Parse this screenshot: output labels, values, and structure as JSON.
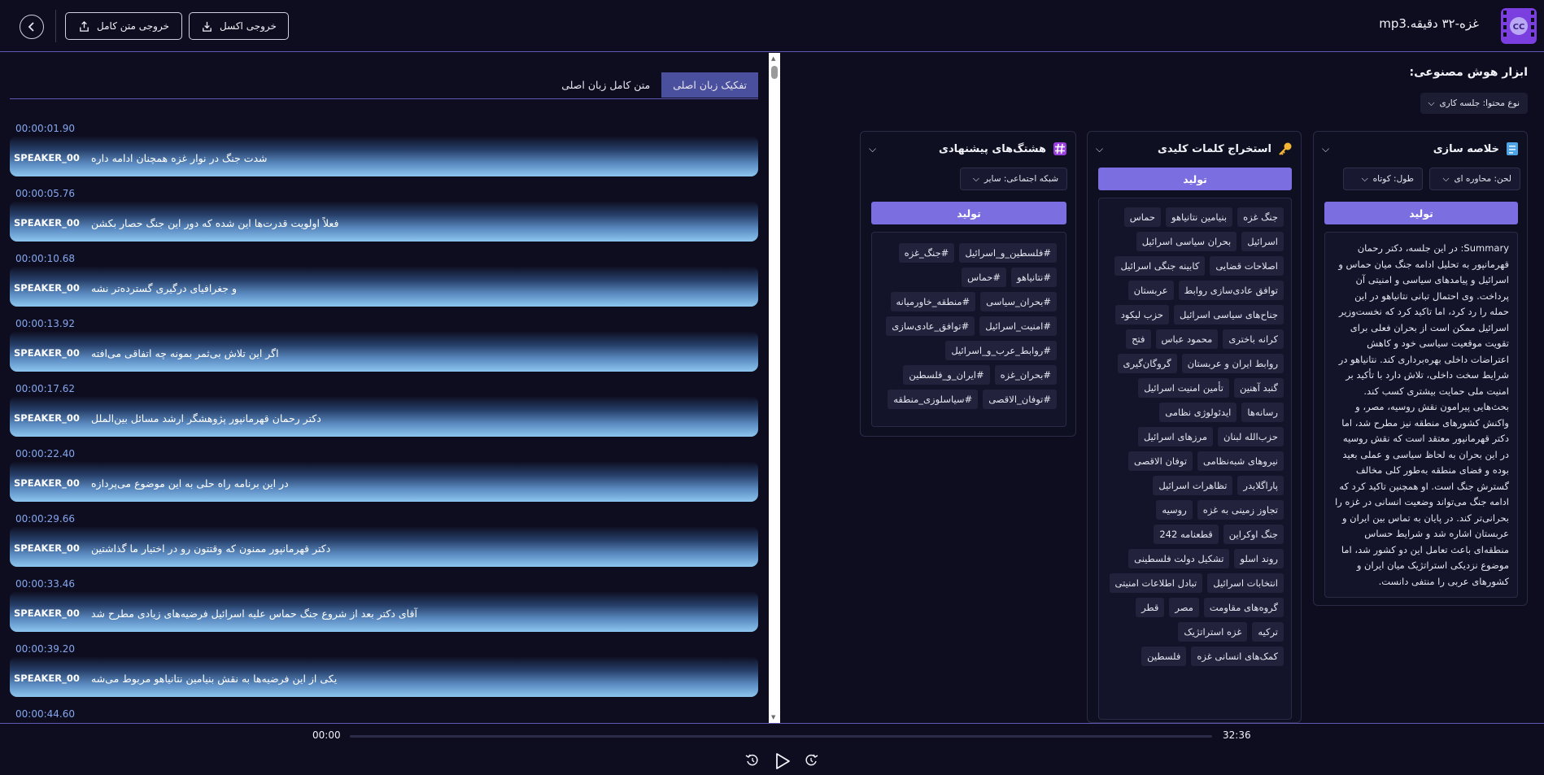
{
  "header": {
    "file_title": "غزه-۳۲ دقیقه.mp3",
    "export_full_label": "خروجی متن کامل",
    "export_excel_label": "خروجی اکسل",
    "logo_text": "CC"
  },
  "transcript": {
    "tabs": [
      {
        "label": "تفکیک زبان اصلی",
        "active": true
      },
      {
        "label": "متن کامل زبان اصلی",
        "active": false
      }
    ],
    "segments": [
      {
        "time": "00:00:01.90",
        "speaker": "SPEAKER_00",
        "text": "شدت جنگ در نوار غزه همچنان ادامه داره"
      },
      {
        "time": "00:00:05.76",
        "speaker": "SPEAKER_00",
        "text": "فعلاً اولویت قدرت‌ها این شده که دور این جنگ حصار بکشن"
      },
      {
        "time": "00:00:10.68",
        "speaker": "SPEAKER_00",
        "text": "و جغرافیای درگیری گسترده‌تر نشه"
      },
      {
        "time": "00:00:13.92",
        "speaker": "SPEAKER_00",
        "text": "اگر این تلاش بی‌ثمر بمونه چه اتفاقی می‌افته"
      },
      {
        "time": "00:00:17.62",
        "speaker": "SPEAKER_00",
        "text": "دکتر رحمان قهرمانپور پژوهشگر ارشد مسائل بین‌الملل"
      },
      {
        "time": "00:00:22.40",
        "speaker": "SPEAKER_00",
        "text": "در این برنامه راه حلی به این موضوع می‌پردازه"
      },
      {
        "time": "00:00:29.66",
        "speaker": "SPEAKER_00",
        "text": "دکتر قهرمانپور ممنون که وقتتون رو در اختیار ما گذاشتین"
      },
      {
        "time": "00:00:33.46",
        "speaker": "SPEAKER_00",
        "text": "آقای دکتر بعد از شروع جنگ حماس علیه اسرائیل فرضیه‌های زیادی مطرح شد"
      },
      {
        "time": "00:00:39.20",
        "speaker": "SPEAKER_00",
        "text": "یکی از این فرضیه‌ها به نقش بنیامین نتانیاهو مربوط می‌شه"
      },
      {
        "time": "00:00:44.60",
        "speaker": "",
        "text": ""
      }
    ]
  },
  "ai_tools": {
    "title": "ابزار هوش مصنوعی:",
    "content_type_label": "نوع محتوا: جلسه کاری",
    "summary": {
      "title": "خلاصه سازی",
      "tone_label": "لحن: محاوره ای",
      "length_label": "طول: کوتاه",
      "generate_label": "تولید",
      "text": "Summary: در این جلسه، دکتر رحمان قهرمانپور به تحلیل ادامه جنگ میان حماس و اسرائیل و پیامدهای سیاسی و امنیتی آن پرداخت. وی احتمال تبانی نتانیاهو در این حمله را رد کرد، اما تاکید کرد که نخست‌وزیر اسرائیل ممکن است از بحران فعلی برای تقویت موقعیت سیاسی خود و کاهش اعتراضات داخلی بهره‌برداری کند. نتانیاهو در شرایط سخت داخلی، تلاش دارد با تأکید بر امنیت ملی حمایت بیشتری کسب کند. بحث‌هایی پیرامون نقش روسیه، مصر، و واکنش کشورهای منطقه نیز مطرح شد، اما دکتر قهرمانپور معتقد است که نقش روسیه در این بحران به لحاظ سیاسی و عملی بعید بوده و فضای منطقه به‌طور کلی مخالف گسترش جنگ است. او همچنین تاکید کرد که ادامه جنگ می‌تواند وضعیت انسانی در غزه را بحرانی‌تر کند. در پایان به تماس بین ایران و عربستان اشاره شد و شرایط حساس منطقه‌ای باعث تعامل این دو کشور شد، اما موضوع نزدیکی استراتژیک میان ایران و کشورهای عربی را منتفی دانست."
    },
    "keywords": {
      "title": "استخراج کلمات کلیدی",
      "generate_label": "تولید",
      "items": [
        "جنگ غزه",
        "بنیامین نتانیاهو",
        "حماس",
        "اسرائیل",
        "بحران سیاسی اسرائیل",
        "اصلاحات قضایی",
        "کابینه جنگی اسرائیل",
        "توافق عادی‌سازی روابط",
        "عربستان",
        "جناح‌های سیاسی اسرائیل",
        "حزب لیکود",
        "کرانه باختری",
        "محمود عباس",
        "فتح",
        "روابط ایران و عربستان",
        "گروگان‌گیری",
        "گنبد آهنین",
        "تأمین امنیت اسرائیل",
        "رسانه‌ها",
        "ایدئولوژی نظامی",
        "حزب‌الله لبنان",
        "مرزهای اسرائیل",
        "نیروهای شبه‌نظامی",
        "توفان الاقصی",
        "پاراگلایدر",
        "تظاهرات اسرائیل",
        "تجاوز زمینی به غزه",
        "روسیه",
        "جنگ اوکراین",
        "قطعنامه 242",
        "روند اسلو",
        "تشکیل دولت فلسطینی",
        "انتخابات اسرائیل",
        "تبادل اطلاعات امنیتی",
        "گروه‌های مقاومت",
        "مصر",
        "قطر",
        "ترکیه",
        "غزه استراتژیک",
        "کمک‌های انسانی غزه",
        "فلسطین"
      ]
    },
    "hashtags": {
      "title": "هشتگ‌های پیشنهادی",
      "network_label": "شبکه اجتماعی: سایر",
      "generate_label": "تولید",
      "items": [
        "#فلسطین_و_اسرائیل",
        "#جنگ_غزه",
        "#نتانیاهو",
        "#حماس",
        "#بحران_سیاسی",
        "#منطقه_خاورمیانه",
        "#امنیت_اسرائیل",
        "#توافق_عادی‌سازی",
        "#روابط_عرب_و_اسرائیل",
        "#بحران_غزه",
        "#ایران_و_فلسطین",
        "#توفان_الاقصی",
        "#سیاسلوزی_منطقه"
      ]
    }
  },
  "player": {
    "current_time": "00:00",
    "total_time": "32:36",
    "progress": 0.0
  },
  "colors": {
    "accent": "#7b6ee0",
    "background": "#0d0d1f",
    "time_text": "#86a7ee",
    "divider": "#5f58b5"
  }
}
